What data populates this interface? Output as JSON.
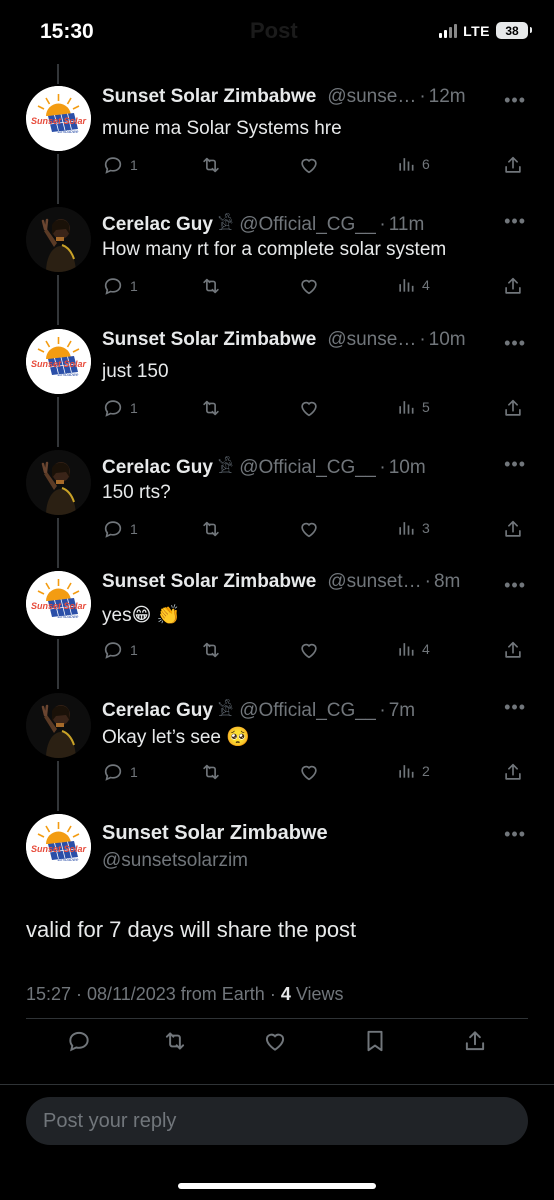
{
  "status_bar": {
    "time": "15:30",
    "network": "LTE",
    "battery": "38"
  },
  "header": {
    "title": "Post"
  },
  "replies": [
    {
      "name": "Sunset Solar Zimbabwe",
      "badge": "",
      "handle": "@sunse…",
      "time": "12m",
      "text": "mune ma Solar Systems hre",
      "stats": {
        "replies": "1",
        "reposts": "",
        "likes": "",
        "views": "6"
      },
      "avatar": "sunset-solar"
    },
    {
      "name": "Cerelac Guy",
      "badge": "𓀀",
      "handle": "@Official_CG__",
      "time": "11m",
      "text": "How many rt for a complete solar system",
      "stats": {
        "replies": "1",
        "reposts": "",
        "likes": "",
        "views": "4"
      },
      "avatar": "cerelac-guy"
    },
    {
      "name": "Sunset Solar Zimbabwe",
      "badge": "",
      "handle": "@sunse…",
      "time": "10m",
      "text": "just 150",
      "stats": {
        "replies": "1",
        "reposts": "",
        "likes": "",
        "views": "5"
      },
      "avatar": "sunset-solar"
    },
    {
      "name": "Cerelac Guy",
      "badge": "𓀀",
      "handle": "@Official_CG__",
      "time": "10m",
      "text": "150 rts?",
      "stats": {
        "replies": "1",
        "reposts": "",
        "likes": "",
        "views": "3"
      },
      "avatar": "cerelac-guy"
    },
    {
      "name": "Sunset Solar Zimbabwe",
      "badge": "",
      "handle": "@sunset…",
      "time": "8m",
      "text": "yes😁 👏",
      "stats": {
        "replies": "1",
        "reposts": "",
        "likes": "",
        "views": "4"
      },
      "avatar": "sunset-solar"
    },
    {
      "name": "Cerelac Guy",
      "badge": "𓀀",
      "handle": "@Official_CG__",
      "time": "7m",
      "text": "Okay let’s see 🥺",
      "stats": {
        "replies": "1",
        "reposts": "",
        "likes": "",
        "views": "2"
      },
      "avatar": "cerelac-guy"
    }
  ],
  "main_tweet": {
    "name": "Sunset Solar Zimbabwe",
    "handle": "@sunsetsolarzim",
    "text": "valid for 7 days will share the post",
    "timestamp": "15:27 · 08/11/2023 from Earth · ",
    "views_count": "4",
    "views_label": " Views"
  },
  "composer": {
    "placeholder": "Post your reply"
  },
  "icons": [
    "reply-icon",
    "repost-icon",
    "like-icon",
    "views-icon",
    "share-icon",
    "bookmark-icon",
    "more-icon"
  ],
  "colors": {
    "background": "#000000",
    "text": "#e7e9ea",
    "muted": "#71767b",
    "divider": "#2f3336"
  }
}
